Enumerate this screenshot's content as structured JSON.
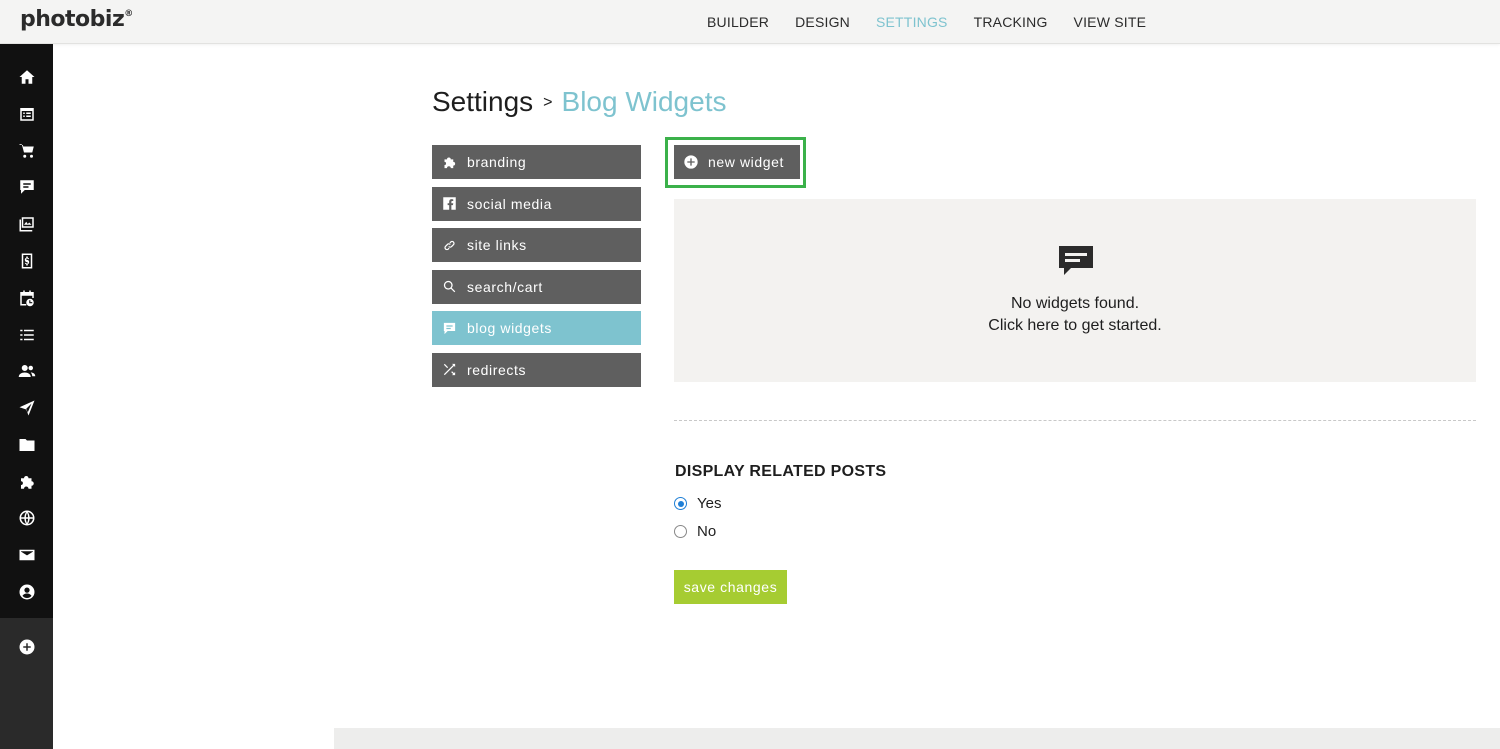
{
  "app": {
    "logo": "photobiz",
    "logo_mark": "®"
  },
  "topnav": [
    {
      "label": "BUILDER",
      "active": false
    },
    {
      "label": "DESIGN",
      "active": false
    },
    {
      "label": "SETTINGS",
      "active": true
    },
    {
      "label": "TRACKING",
      "active": false
    },
    {
      "label": "VIEW SITE",
      "active": false
    }
  ],
  "rail_icons": [
    "home-icon",
    "calendar-list-icon",
    "cart-icon",
    "chat-icon",
    "gallery-icon",
    "invoice-icon",
    "booking-icon",
    "list-icon",
    "contacts-icon",
    "send-icon",
    "folder-icon",
    "puzzle-icon",
    "globe-icon",
    "mail-icon",
    "account-icon",
    "add-icon"
  ],
  "breadcrumb": {
    "root": "Settings",
    "separator": ">",
    "current": "Blog Widgets"
  },
  "settings_menu": [
    {
      "label": "branding",
      "icon": "puzzle-icon",
      "active": false
    },
    {
      "label": "social media",
      "icon": "facebook-icon",
      "active": false
    },
    {
      "label": "site links",
      "icon": "link-icon",
      "active": false
    },
    {
      "label": "search/cart",
      "icon": "search-icon",
      "active": false
    },
    {
      "label": "blog widgets",
      "icon": "chat-icon",
      "active": true
    },
    {
      "label": "redirects",
      "icon": "shuffle-icon",
      "active": false
    }
  ],
  "new_widget": {
    "label": "new widget",
    "icon": "plus-circle-icon"
  },
  "empty_state": {
    "icon": "chat-icon",
    "line1": "No widgets found.",
    "line2": "Click here to get started."
  },
  "related_posts": {
    "title": "DISPLAY RELATED POSTS",
    "options": [
      {
        "label": "Yes",
        "selected": true
      },
      {
        "label": "No",
        "selected": false
      }
    ]
  },
  "save_button": {
    "label": "save changes"
  },
  "colors": {
    "accent": "#7ec3cf",
    "menu_gray": "#5f5f5f",
    "save_green": "#a6cc32",
    "highlight_green": "#3bb14a",
    "rail": "#111111"
  }
}
